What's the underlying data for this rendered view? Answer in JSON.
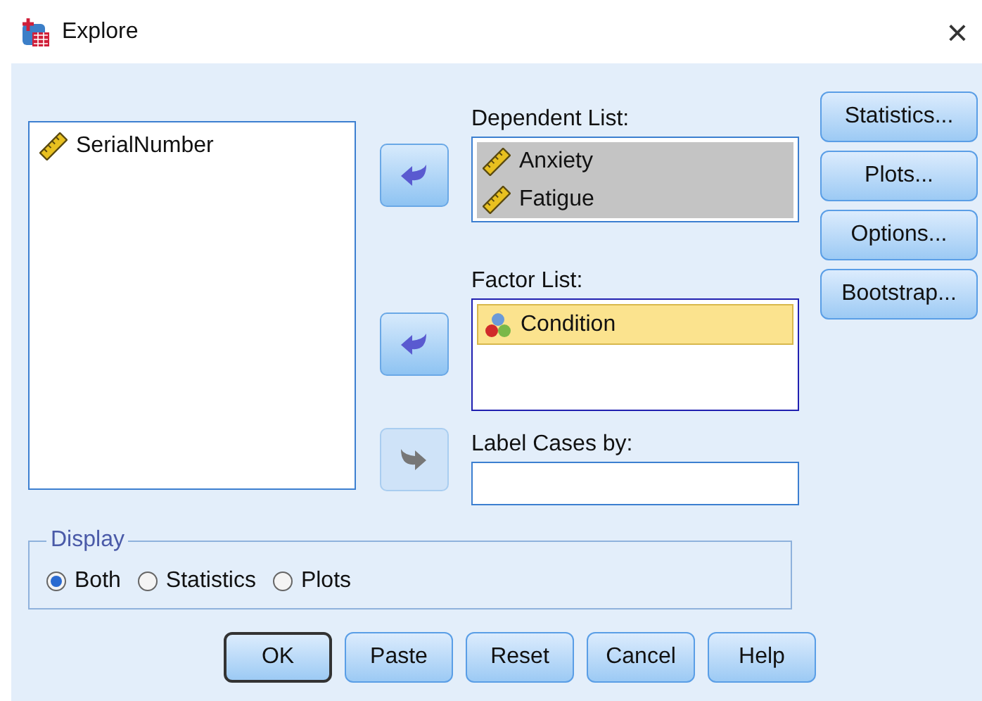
{
  "window": {
    "title": "Explore",
    "close": "×"
  },
  "source_list": {
    "items": [
      {
        "label": "SerialNumber",
        "kind": "scale",
        "selected": false
      }
    ]
  },
  "arrows": [
    {
      "kind": "left",
      "disabled": false
    },
    {
      "kind": "left",
      "disabled": false
    },
    {
      "kind": "right",
      "disabled": true
    }
  ],
  "dependent_list": {
    "label": "Dependent List:",
    "focused": false,
    "items": [
      {
        "label": "Anxiety",
        "kind": "scale",
        "selected": true
      },
      {
        "label": "Fatigue",
        "kind": "scale",
        "selected": true
      }
    ]
  },
  "factor_list": {
    "label": "Factor List:",
    "focused": true,
    "items": [
      {
        "label": "Condition",
        "kind": "nominal",
        "selected": true
      }
    ]
  },
  "label_cases": {
    "label": "Label Cases by:"
  },
  "side_buttons": [
    "Statistics...",
    "Plots...",
    "Options...",
    "Bootstrap..."
  ],
  "display": {
    "title": "Display",
    "options": [
      {
        "label": "Both",
        "selected": true
      },
      {
        "label": "Statistics",
        "selected": false
      },
      {
        "label": "Plots",
        "selected": false
      }
    ]
  },
  "buttons": [
    {
      "label": "OK",
      "default": true
    },
    {
      "label": "Paste",
      "default": false
    },
    {
      "label": "Reset",
      "default": false
    },
    {
      "label": "Cancel",
      "default": false
    },
    {
      "label": "Help",
      "default": false
    }
  ]
}
